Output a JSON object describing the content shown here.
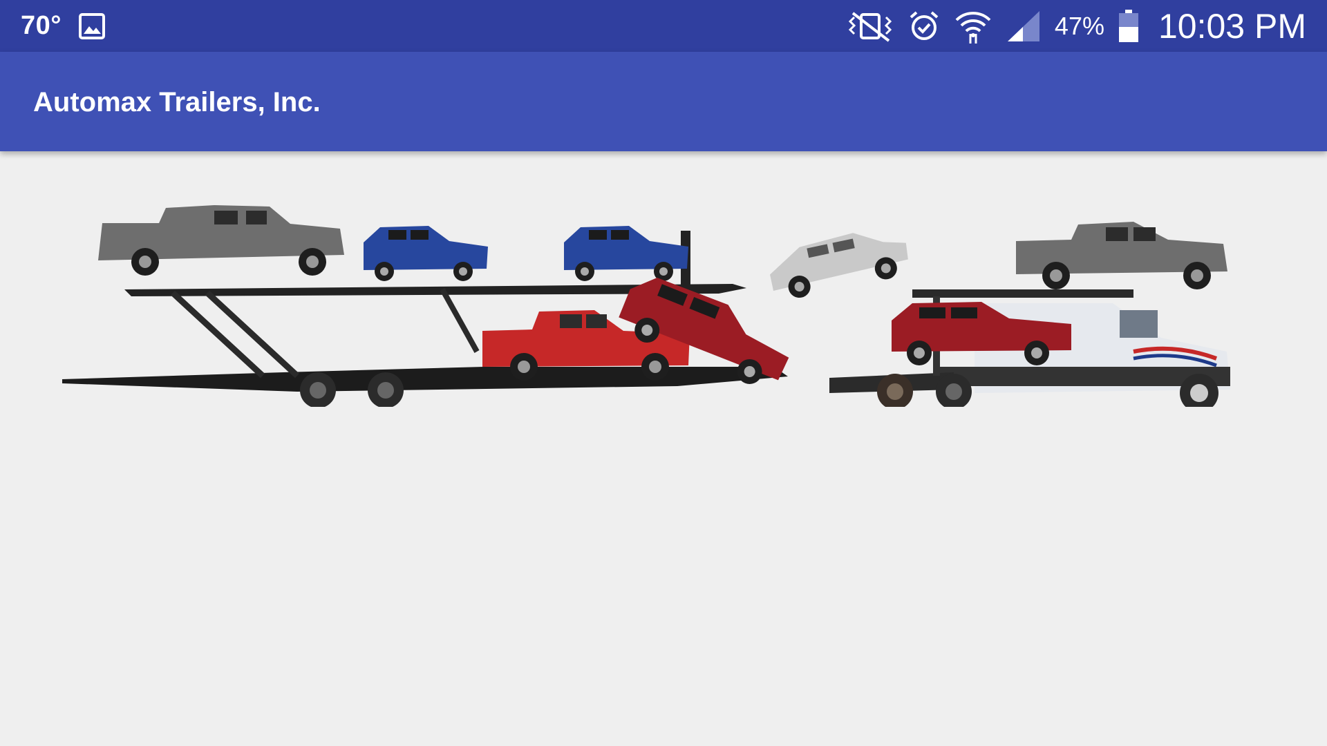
{
  "status_bar": {
    "temperature": "70°",
    "battery_percent": "47%",
    "time": "10:03 PM",
    "icons": [
      "image-notification-icon",
      "vibrate-icon",
      "alarm-icon",
      "wifi-icon",
      "signal-icon",
      "battery-icon"
    ]
  },
  "app_bar": {
    "title": "Automax Trailers, Inc."
  },
  "hero_image": {
    "subject": "car-hauler-truck",
    "colors": {
      "status_bar": "#303f9f",
      "app_bar": "#3f51b5",
      "background": "#efefef"
    }
  }
}
